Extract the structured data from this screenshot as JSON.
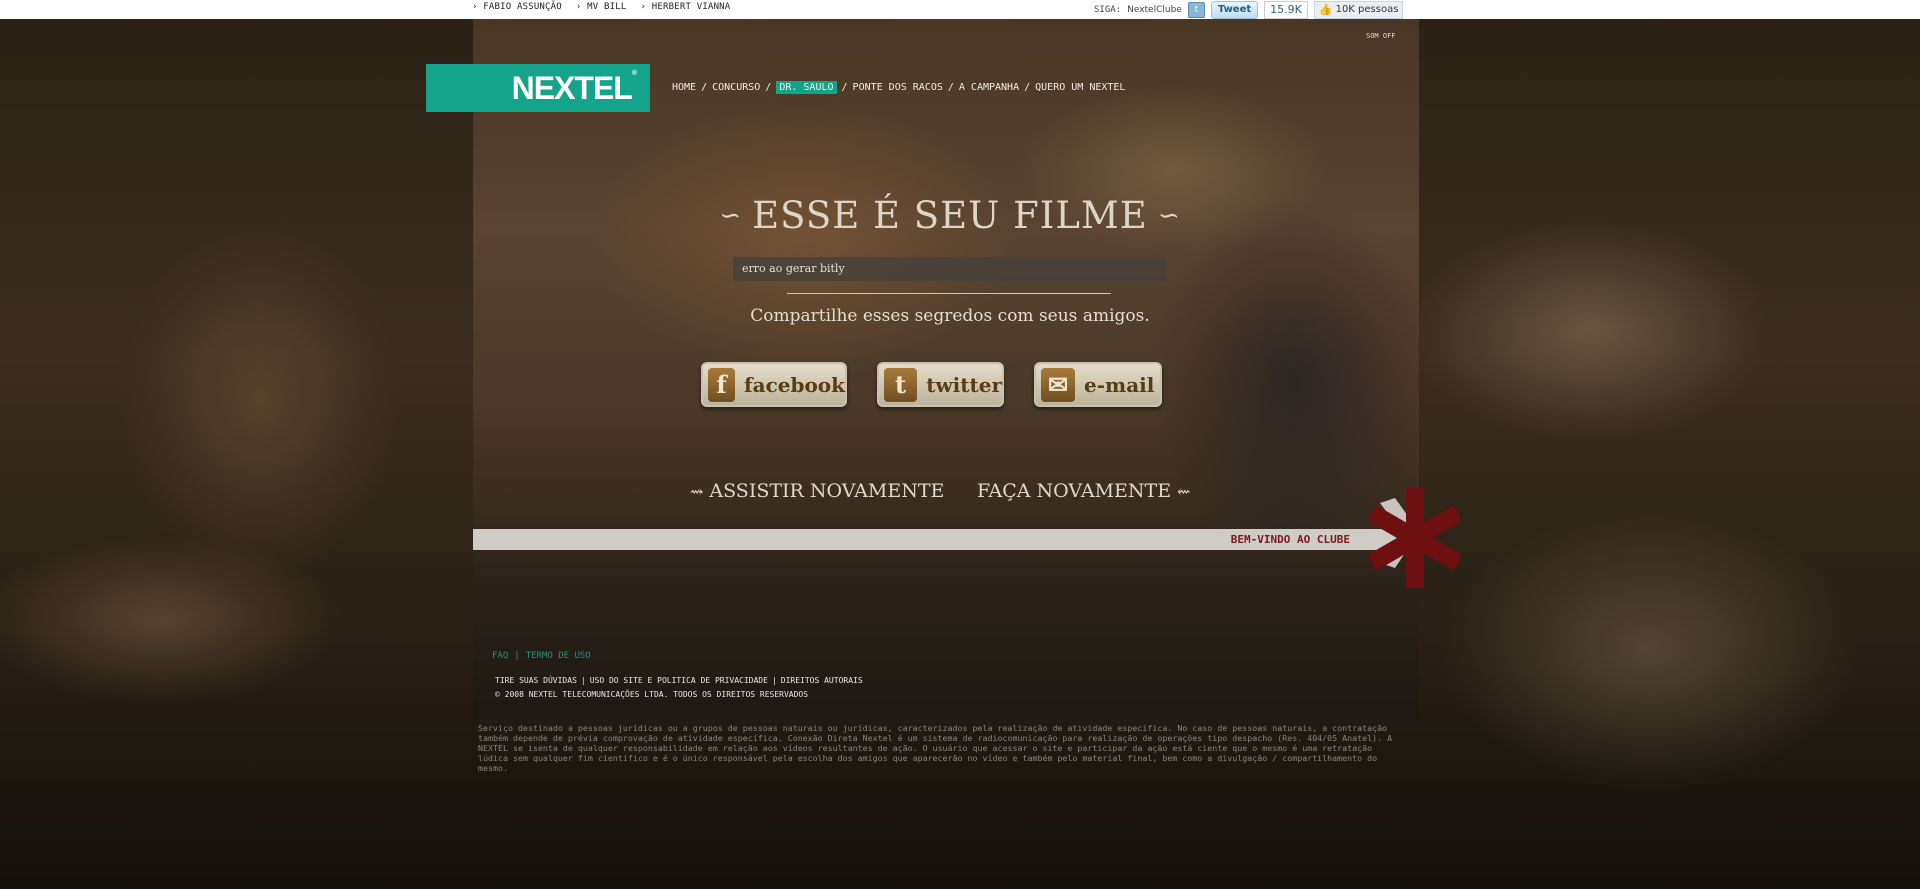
{
  "topbar": {
    "links": [
      "FABIO ASSUNÇÃO",
      "MV BILL",
      "HERBERT VIANNA"
    ],
    "siga": "SIGA:",
    "nextel_clube": "NextelClube",
    "tweet": "Tweet",
    "tweet_count": "15.9K",
    "like": "10K pessoas"
  },
  "som_off": "SOM OFF",
  "logo": "NEXTEL",
  "nav": {
    "items": [
      "HOME",
      "CONCURSO",
      "DR. SAULO",
      "PONTE DOS RACOS",
      "A CAMPANHA",
      "QUERO UM NEXTEL"
    ],
    "active": "DR. SAULO"
  },
  "main": {
    "heading": "ESSE É SEU FILME",
    "url_value": "erro ao gerar bitly",
    "share_text": "Compartilhe esses segredos com seus amigos.",
    "facebook": "facebook",
    "twitter": "twitter",
    "email": "e-mail",
    "assistir": "ASSISTIR NOVAMENTE",
    "faca": "FAÇA NOVAMENTE"
  },
  "welcome": "BEM-VINDO AO CLUBE",
  "footer": {
    "faq": "FAQ",
    "termo": "TERMO DE USO",
    "duvidas": "TIRE SUAS DÚVIDAS",
    "uso": "USO DO SITE E POLITICA DE PRIVACIDADE",
    "direitos": "DIREITOS AUTORAIS",
    "copyright": "© 2008 NEXTEL TELECOMUNICAÇÕES LTDA. TODOS OS DIREITOS RESERVADOS"
  },
  "disclaimer": "Serviço destinado a pessoas jurídicas ou a grupos de pessoas naturais ou jurídicas, caracterizados pela realização de atividade específica. No caso de pessoas naturais, a contratação também depende de prévia comprovação de atividade específica. Conexão Direta Nextel é um sistema de radiocomunicação para realização de operações tipo despacho (Res. 404/05 Anatel). A NEXTEL se isenta de qualquer responsabilidade em relação aos vídeos resultantes de ação. O usuário que acessar o site e participar da ação está ciente que o mesmo é uma retratação lúdica sem qualquer fim científico e é o único responsável pela escolha dos amigos que aparecerão no vídeo e também pelo material final, bem como a divulgação / compartilhamento do mesmo.",
  "colors": {
    "brand": "#14a38b",
    "welcome_text": "#7a1c1a",
    "star": "#6e0f12"
  }
}
